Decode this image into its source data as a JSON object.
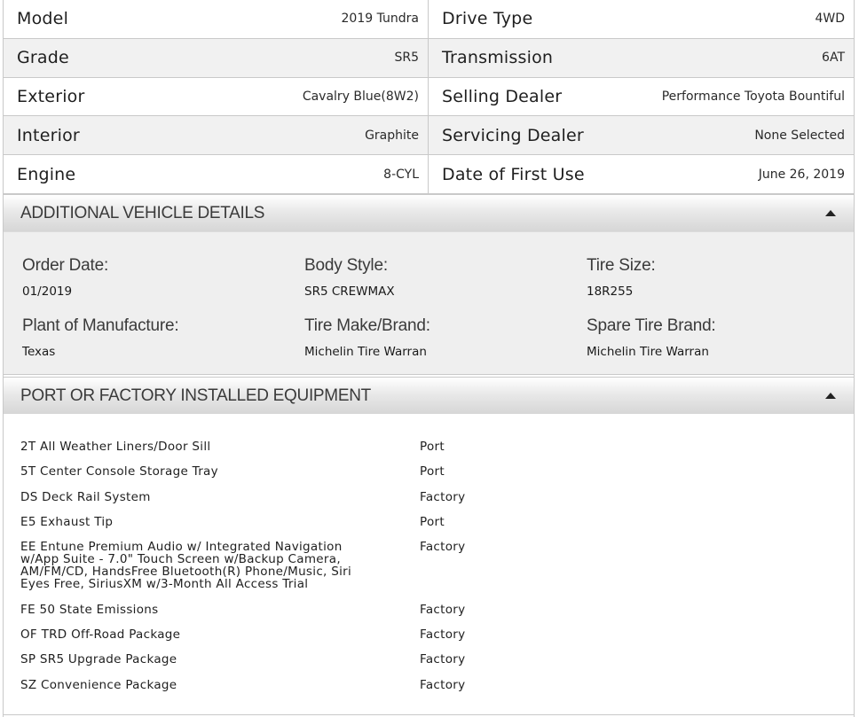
{
  "specs": [
    {
      "label": "Model",
      "value": "2019 Tundra"
    },
    {
      "label": "Drive Type",
      "value": "4WD"
    },
    {
      "label": "Grade",
      "value": "SR5"
    },
    {
      "label": "Transmission",
      "value": "6AT"
    },
    {
      "label": "Exterior",
      "value": "Cavalry Blue(8W2)"
    },
    {
      "label": "Selling Dealer",
      "value": "Performance Toyota Bountiful"
    },
    {
      "label": "Interior",
      "value": "Graphite"
    },
    {
      "label": "Servicing Dealer",
      "value": "None Selected"
    },
    {
      "label": "Engine",
      "value": "8-CYL"
    },
    {
      "label": "Date of First Use",
      "value": "June 26, 2019"
    }
  ],
  "additional": {
    "title": "ADDITIONAL VEHICLE DETAILS",
    "toggle_icon": "caret-up-icon",
    "items": [
      {
        "label": "Order Date:",
        "value": "01/2019"
      },
      {
        "label": "Body Style:",
        "value": "SR5 CREWMAX"
      },
      {
        "label": "Tire Size:",
        "value": "18R255"
      },
      {
        "label": "Plant of Manufacture:",
        "value": "Texas"
      },
      {
        "label": "Tire Make/Brand:",
        "value": "Michelin Tire Warran"
      },
      {
        "label": "Spare Tire Brand:",
        "value": "Michelin Tire Warran"
      }
    ]
  },
  "equipment": {
    "title": "PORT OR FACTORY INSTALLED EQUIPMENT",
    "toggle_icon": "caret-up-icon",
    "items": [
      {
        "desc": "2T All Weather Liners/Door Sill",
        "type": "Port"
      },
      {
        "desc": "5T Center Console Storage Tray",
        "type": "Port"
      },
      {
        "desc": "DS Deck Rail System",
        "type": "Factory"
      },
      {
        "desc": "E5 Exhaust Tip",
        "type": "Port"
      },
      {
        "desc": "EE Entune Premium Audio w/ Integrated Navigation w/App Suite - 7.0\" Touch Screen w/Backup Camera, AM/FM/CD, HandsFree Bluetooth(R) Phone/Music, Siri Eyes Free, SiriusXM w/3-Month All Access Trial",
        "type": "Factory"
      },
      {
        "desc": "FE 50 State Emissions",
        "type": "Factory"
      },
      {
        "desc": "OF TRD Off-Road Package",
        "type": "Factory"
      },
      {
        "desc": "SP SR5 Upgrade Package",
        "type": "Factory"
      },
      {
        "desc": "SZ Convenience Package",
        "type": "Factory"
      }
    ]
  }
}
